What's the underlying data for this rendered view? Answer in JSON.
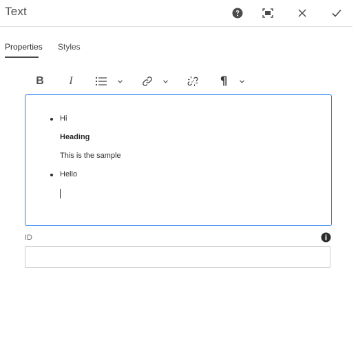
{
  "dialog": {
    "title": "Text"
  },
  "header_buttons": [
    {
      "name": "help-icon"
    },
    {
      "name": "fullscreen-icon"
    },
    {
      "name": "close-icon"
    },
    {
      "name": "checkmark-icon"
    }
  ],
  "tabs": [
    {
      "label": "Properties",
      "active": true
    },
    {
      "label": "Styles",
      "active": false
    }
  ],
  "toolbar": {
    "bold_label": "B",
    "italic_label": "I",
    "paragraph_label": "¶",
    "icons": [
      "bold-icon",
      "italic-icon",
      "list-icon",
      "chevron-down-icon",
      "link-icon",
      "unlink-icon",
      "paragraph-icon"
    ]
  },
  "editor": {
    "lines": [
      {
        "text": "Hi",
        "bullet": true,
        "bold": false
      },
      {
        "text": "Heading",
        "bullet": false,
        "bold": true
      },
      {
        "text": "This is the sample",
        "bullet": false,
        "bold": false
      },
      {
        "text": "Hello",
        "bullet": true,
        "bold": false
      }
    ]
  },
  "id_field": {
    "label": "ID",
    "value": "",
    "placeholder": ""
  },
  "colors": {
    "accent": "#2680eb",
    "text": "#2c2c2c",
    "border": "#cacaca"
  }
}
